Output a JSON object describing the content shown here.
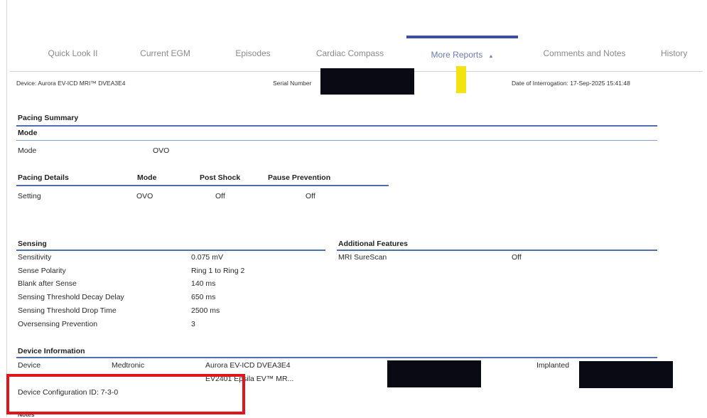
{
  "tabs": [
    "Quick Look II",
    "Current EGM",
    "Episodes",
    "Cardiac Compass",
    "More Reports",
    "Comments and Notes",
    "History"
  ],
  "more_reports_caret": "▲",
  "device_header": {
    "device": "Device: Aurora EV-ICD MRI™ DVEA3E4",
    "serial_label": "Serial Number",
    "interrogation": "Date of Interrogation: 17-Sep-2025 15:41:48"
  },
  "pacing_summary": {
    "title": "Pacing Summary",
    "mode_header": "Mode",
    "mode_label": "Mode",
    "mode_value": "OVO"
  },
  "pacing_details": {
    "headers": [
      "Pacing Details",
      "Mode",
      "Post Shock",
      "Pause Prevention"
    ],
    "row": [
      "Setting",
      "OVO",
      "Off",
      "Off"
    ]
  },
  "sensing": {
    "title": "Sensing",
    "rows": [
      {
        "label": "Sensitivity",
        "value": "0.075 mV"
      },
      {
        "label": "Sense Polarity",
        "value": "Ring 1 to Ring 2"
      },
      {
        "label": "Blank after Sense",
        "value": "140 ms"
      },
      {
        "label": "Sensing Threshold Decay Delay",
        "value": "650 ms"
      },
      {
        "label": "Sensing Threshold Drop Time",
        "value": "2500 ms"
      },
      {
        "label": "Oversensing Prevention",
        "value": "3"
      }
    ]
  },
  "additional_features": {
    "title": "Additional Features",
    "label": "MRI SureScan",
    "value": "Off"
  },
  "device_information": {
    "title": "Device Information",
    "device_label": "Device",
    "manufacturer": "Medtronic",
    "model": "Aurora EV-ICD DVEA3E4",
    "lead": "EV2401 Epsila EV™ MR...",
    "implanted_label": "Implanted",
    "config": "Device Configuration ID: 7-3-0",
    "notes": "Notes"
  },
  "colors": {
    "accent": "#3d4f9a",
    "highlight_box": "#e0151b",
    "marker": "#f4e312"
  }
}
